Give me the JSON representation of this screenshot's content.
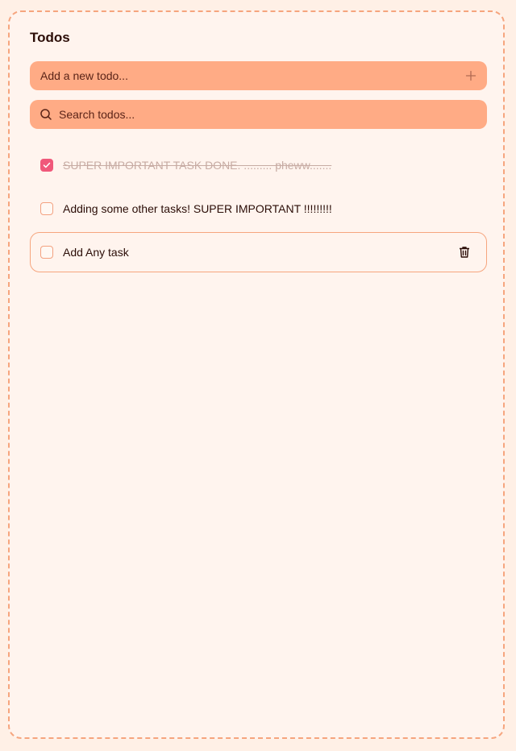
{
  "header": {
    "title": "Todos"
  },
  "add_input": {
    "placeholder": "Add a new todo..."
  },
  "search_input": {
    "placeholder": "Search todos..."
  },
  "todos": [
    {
      "text": "SUPER IMPORTANT TASK DONE. ......... pheww.......",
      "completed": true
    },
    {
      "text": "Adding some other tasks! SUPER IMPORTANT !!!!!!!!!",
      "completed": false
    },
    {
      "text": "Add Any task",
      "completed": false
    }
  ],
  "colors": {
    "background": "#fff0e6",
    "accent": "#ffab85",
    "checked": "#f0587a",
    "text": "#2b0d07"
  },
  "icons": [
    "plus-icon",
    "search-icon",
    "check-icon",
    "trash-icon"
  ]
}
